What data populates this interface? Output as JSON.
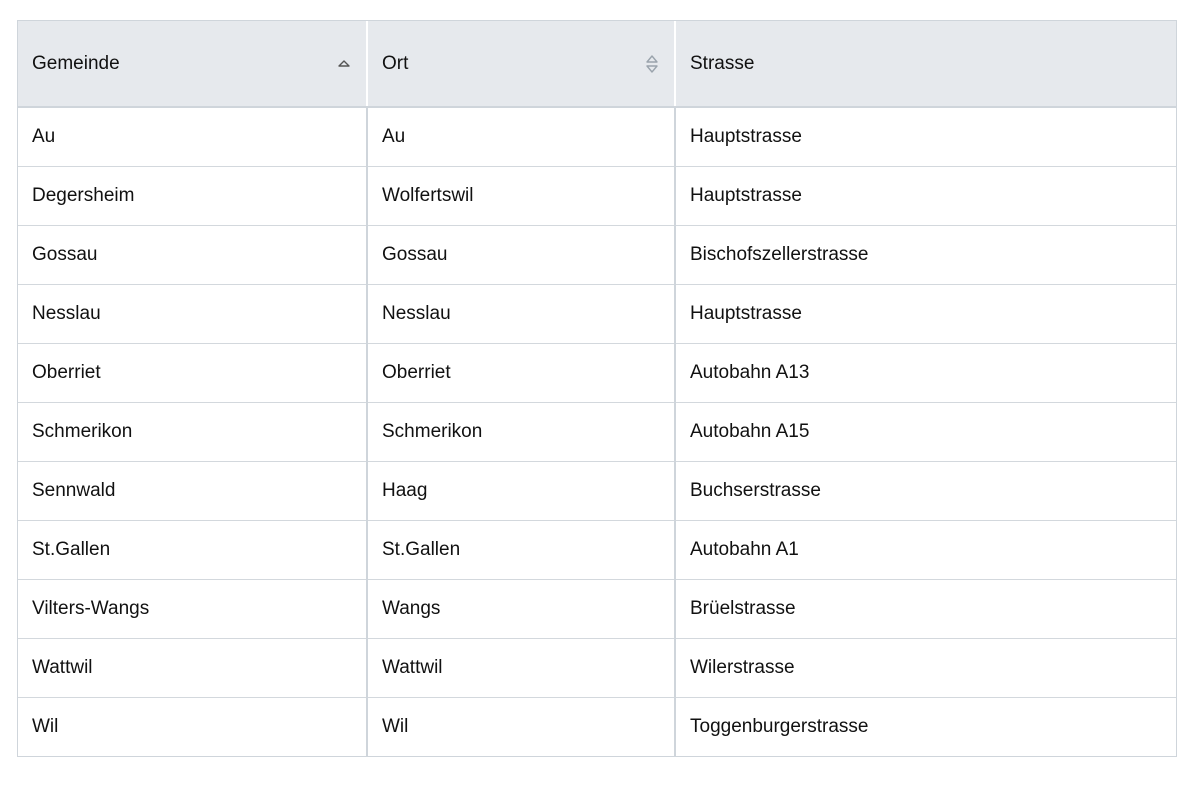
{
  "table": {
    "columns": [
      {
        "label": "Gemeinde",
        "sort": "ascending",
        "icon": "sort-ascending-icon"
      },
      {
        "label": "Ort",
        "sort": "none",
        "icon": "sort-both-icon"
      },
      {
        "label": "Strasse",
        "sort": null,
        "icon": null
      }
    ],
    "rows": [
      [
        "Au",
        "Au",
        "Hauptstrasse"
      ],
      [
        "Degersheim",
        "Wolfertswil",
        "Hauptstrasse"
      ],
      [
        "Gossau",
        "Gossau",
        "Bischofszellerstrasse"
      ],
      [
        "Nesslau",
        "Nesslau",
        "Hauptstrasse"
      ],
      [
        "Oberriet",
        "Oberriet",
        "Autobahn A13"
      ],
      [
        "Schmerikon",
        "Schmerikon",
        "Autobahn A15"
      ],
      [
        "Sennwald",
        "Haag",
        "Buchserstrasse"
      ],
      [
        "St.Gallen",
        "St.Gallen",
        "Autobahn A1"
      ],
      [
        "Vilters-Wangs",
        "Wangs",
        "Brüelstrasse"
      ],
      [
        "Wattwil",
        "Wattwil",
        "Wilerstrasse"
      ],
      [
        "Wil",
        "Wil",
        "Toggenburgerstrasse"
      ]
    ]
  },
  "colors": {
    "header_bg": "#e6e9ed",
    "border": "#cfd5db",
    "sort_active": "#555555",
    "sort_inactive": "#9aa3ac"
  }
}
